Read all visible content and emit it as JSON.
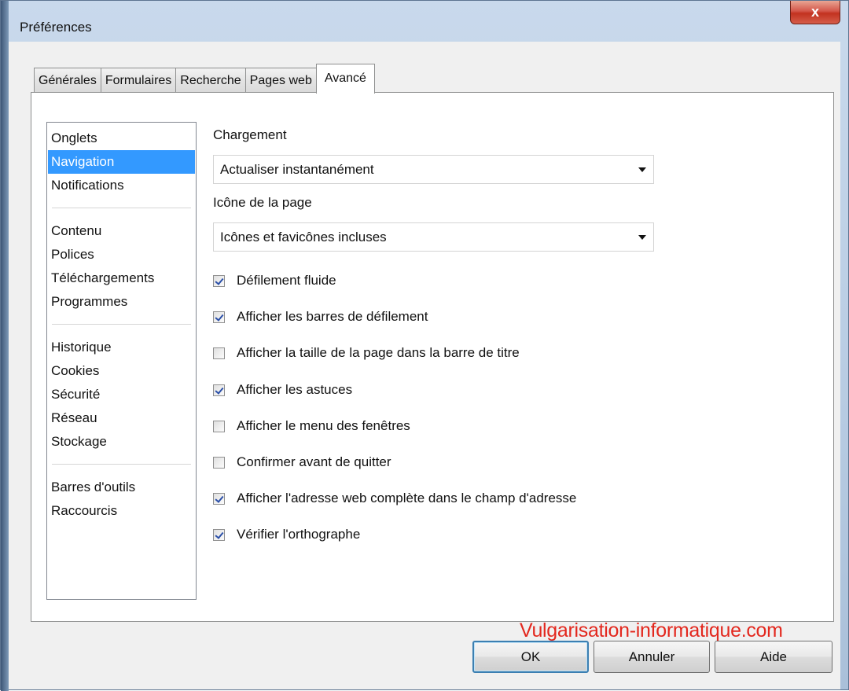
{
  "window": {
    "title": "Préférences",
    "close_label": "x"
  },
  "tabs": [
    {
      "label": "Générales",
      "active": false
    },
    {
      "label": "Formulaires",
      "active": false
    },
    {
      "label": "Recherche",
      "active": false
    },
    {
      "label": "Pages web",
      "active": false
    },
    {
      "label": "Avancé",
      "active": true
    }
  ],
  "categories": {
    "groups": [
      [
        "Onglets",
        "Navigation",
        "Notifications"
      ],
      [
        "Contenu",
        "Polices",
        "Téléchargements",
        "Programmes"
      ],
      [
        "Historique",
        "Cookies",
        "Sécurité",
        "Réseau",
        "Stockage"
      ],
      [
        "Barres d'outils",
        "Raccourcis"
      ]
    ],
    "selected": "Navigation"
  },
  "loading": {
    "label": "Chargement",
    "value": "Actualiser instantanément"
  },
  "page_icon": {
    "label": "Icône de la page",
    "value": "Icônes et favicônes incluses"
  },
  "options": [
    {
      "label": "Défilement fluide",
      "checked": true
    },
    {
      "label": "Afficher les barres de défilement",
      "checked": true
    },
    {
      "label": "Afficher la taille de la page dans la barre de titre",
      "checked": false
    },
    {
      "label": "Afficher les astuces",
      "checked": true
    },
    {
      "label": "Afficher le menu des fenêtres",
      "checked": false
    },
    {
      "label": "Confirmer avant de quitter",
      "checked": false
    },
    {
      "label": "Afficher l'adresse web complète dans le champ d'adresse",
      "checked": true
    },
    {
      "label": "Vérifier l'orthographe",
      "checked": true
    }
  ],
  "buttons": {
    "ok": "OK",
    "cancel": "Annuler",
    "help": "Aide"
  },
  "watermark": "Vulgarisation-informatique.com"
}
